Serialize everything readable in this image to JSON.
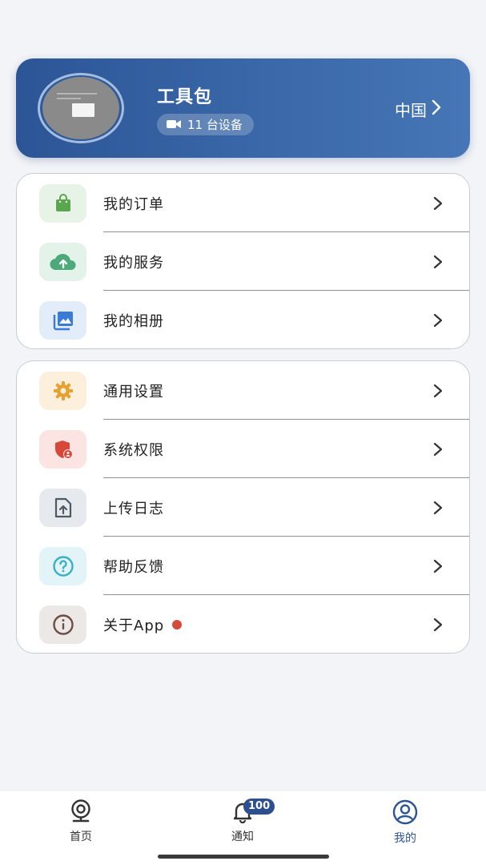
{
  "profile": {
    "name": "工具包",
    "device_count": "11 台设备",
    "region": "中国"
  },
  "menu_group_1": [
    {
      "label": "我的订单",
      "icon": "shopping-bag-icon",
      "color": "#5aa64e",
      "bg": "#e7f3e6"
    },
    {
      "label": "我的服务",
      "icon": "cloud-upload-icon",
      "color": "#4ca97a",
      "bg": "#e4f3ea"
    },
    {
      "label": "我的相册",
      "icon": "photo-album-icon",
      "color": "#3b7bd6",
      "bg": "#e3edfa"
    }
  ],
  "menu_group_2": [
    {
      "label": "通用设置",
      "icon": "gear-icon",
      "color": "#e8a030",
      "bg": "#fcefdc"
    },
    {
      "label": "系统权限",
      "icon": "shield-user-icon",
      "color": "#d8473a",
      "bg": "#fbe4e2"
    },
    {
      "label": "上传日志",
      "icon": "file-upload-icon",
      "color": "#5d6b78",
      "bg": "#e6eaee"
    },
    {
      "label": "帮助反馈",
      "icon": "help-icon",
      "color": "#3ab0c8",
      "bg": "#e2f4f8"
    },
    {
      "label": "关于App",
      "icon": "info-icon",
      "color": "#6d4d44",
      "bg": "#ece8e6",
      "has_dot": true
    }
  ],
  "bottom_nav": {
    "home": "首页",
    "notify": "通知",
    "notify_badge": "100",
    "mine": "我的"
  }
}
